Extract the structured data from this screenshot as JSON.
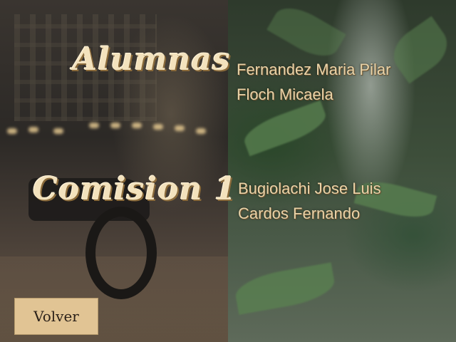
{
  "headings": {
    "alumnas": "Alumnas",
    "comision": "Comision 1"
  },
  "alumnas": [
    "Fernandez Maria Pilar",
    "Floch Micaela"
  ],
  "comision": [
    "Bugiolachi Jose Luis",
    "Cardos Fernando"
  ],
  "button": {
    "volver": "Volver"
  },
  "colors": {
    "text": "#e9d3a8",
    "button_bg": "#e1c494",
    "heading": "#f3e2bd"
  }
}
